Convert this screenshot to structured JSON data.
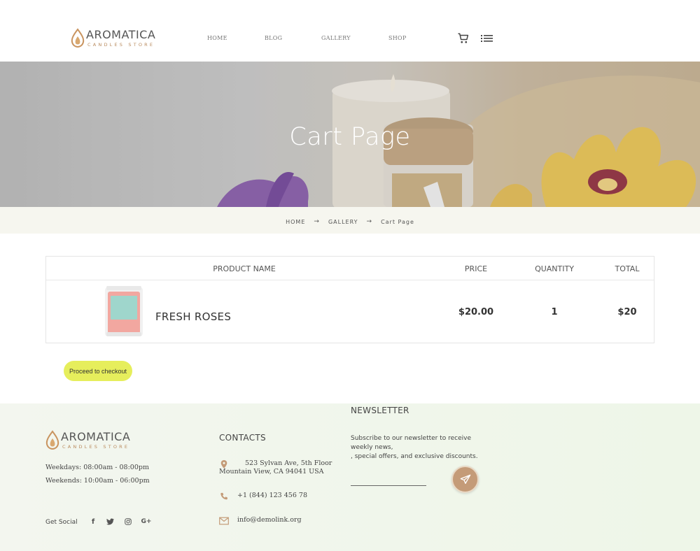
{
  "brand": {
    "name": "AROMATICA",
    "tagline": "CANDLES STORE"
  },
  "nav": {
    "items": [
      {
        "label": "HOME"
      },
      {
        "label": "BLOG"
      },
      {
        "label": "GALLERY"
      },
      {
        "label": "SHOP"
      }
    ],
    "icons": [
      "cart-icon",
      "menu-list-icon"
    ]
  },
  "hero": {
    "title": "Cart Page"
  },
  "breadcrumb": {
    "items": [
      "HOME",
      "GALLERY",
      "Cart Page"
    ]
  },
  "cart": {
    "headers": {
      "product": "PRODUCT NAME",
      "price": "PRICE",
      "quantity": "QUANTITY",
      "total": "TOTAL"
    },
    "rows": [
      {
        "product": "FRESH ROSES",
        "price": "$20.00",
        "quantity": "1",
        "total": "$20"
      }
    ],
    "checkout_label": "Proceed to checkout"
  },
  "footer": {
    "hours": {
      "weekdays_label": "Weekdays:",
      "weekdays_value": "08:00am - 08:00pm",
      "weekends_label": "Weekends:",
      "weekends_value": "10:00am - 06:00pm"
    },
    "social_label": "Get Social",
    "social_icons": [
      "facebook-icon",
      "twitter-icon",
      "instagram-icon",
      "google-plus-icon"
    ],
    "contacts": {
      "heading": "CONTACTS",
      "address_line1": "523 Sylvan Ave, 5th Floor",
      "address_line2": "Mountain View, CA 94041 USA",
      "phone": "+1 (844) 123 456 78",
      "email": "info@demolink.org"
    },
    "newsletter": {
      "heading": "NEWSLETTER",
      "text_line1": "Subscribe to our newsletter to receive weekly news,",
      "text_line2": ", special offers, and exclusive discounts.",
      "input_placeholder": ""
    }
  },
  "colors": {
    "accent_yellow": "#e6ee5c",
    "accent_brown": "#c49b78",
    "logo_tan": "#b98b5e",
    "breadcrumb_bg": "#f6f6ef",
    "footer_bg": "#f0f6ea"
  }
}
